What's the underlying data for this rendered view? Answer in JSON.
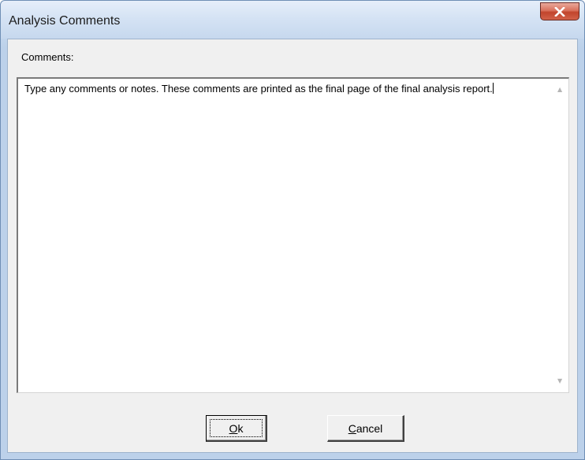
{
  "window": {
    "title": "Analysis Comments"
  },
  "titlebar": {
    "close_icon": "close-x-icon"
  },
  "comments": {
    "label": "Comments:",
    "text": "Type any comments or notes. These comments are printed as the final page of the final analysis report."
  },
  "buttons": {
    "ok_label": "Ok",
    "cancel_label": "Cancel"
  },
  "colors": {
    "title_gradient_top": "#e6eefa",
    "close_button_red": "#c1442c",
    "dialog_background": "#f0f0f0"
  }
}
